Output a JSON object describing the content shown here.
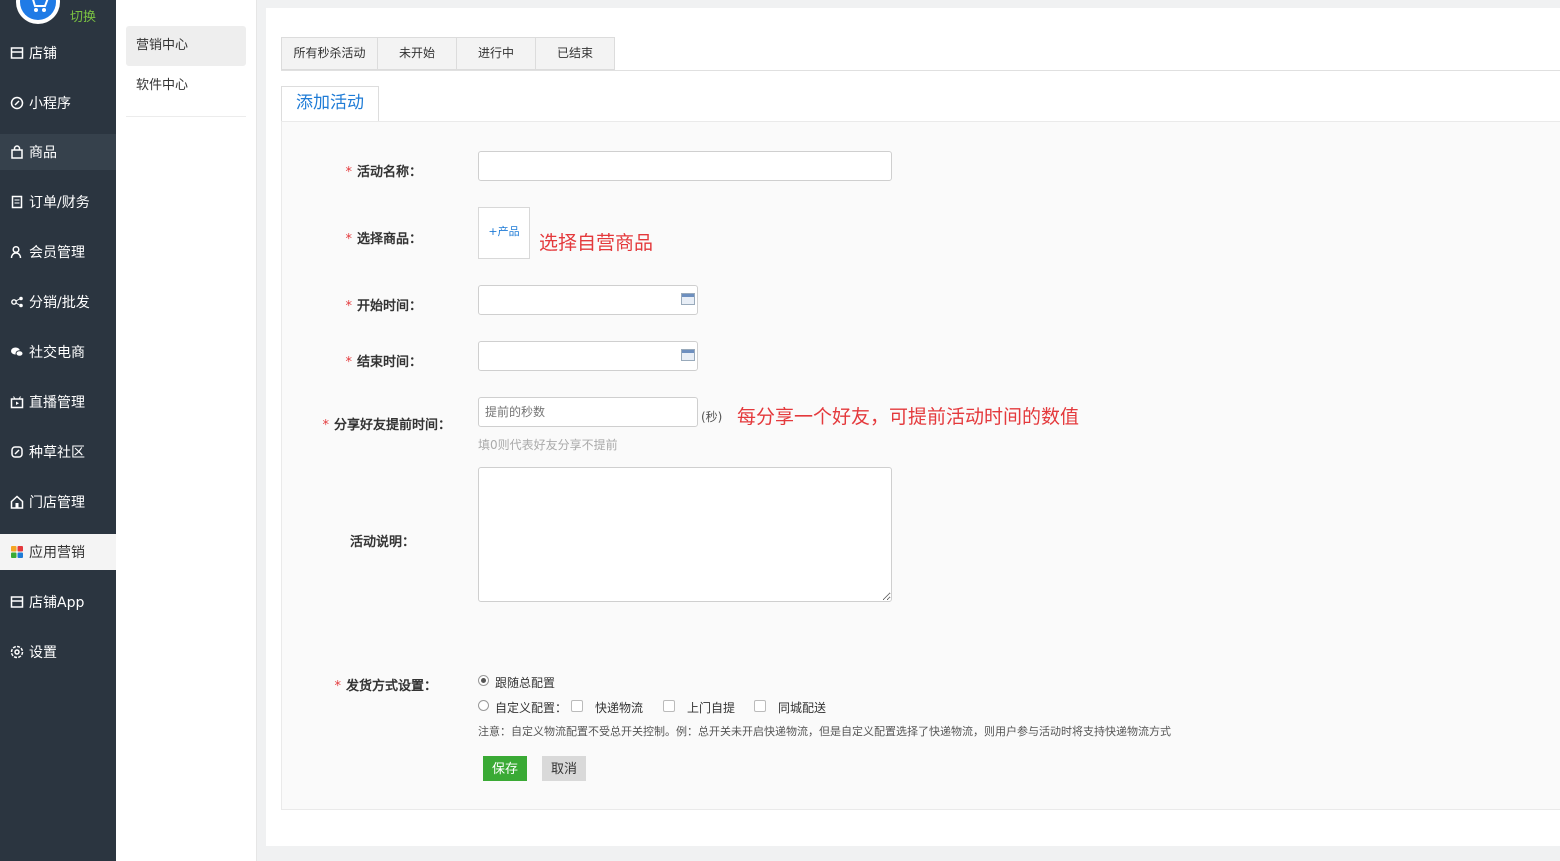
{
  "sidebar": {
    "switch_label": "切换",
    "items": [
      {
        "label": "店铺",
        "icon": "store-icon"
      },
      {
        "label": "小程序",
        "icon": "link-icon"
      },
      {
        "label": "商品",
        "icon": "bag-icon"
      },
      {
        "label": "订单/财务",
        "icon": "clipboard-icon"
      },
      {
        "label": "会员管理",
        "icon": "user-icon"
      },
      {
        "label": "分销/批发",
        "icon": "share-nodes-icon"
      },
      {
        "label": "社交电商",
        "icon": "chat-icon"
      },
      {
        "label": "直播管理",
        "icon": "video-icon"
      },
      {
        "label": "种草社区",
        "icon": "leaf-icon"
      },
      {
        "label": "门店管理",
        "icon": "home-icon"
      },
      {
        "label": "应用营销",
        "icon": "apps-icon"
      },
      {
        "label": "店铺App",
        "icon": "store-icon"
      },
      {
        "label": "设置",
        "icon": "gear-icon"
      }
    ],
    "active_index": 10
  },
  "subnav": {
    "items": [
      {
        "label": "营销中心"
      },
      {
        "label": "软件中心"
      }
    ]
  },
  "tabs": [
    "所有秒杀活动",
    "未开始",
    "进行中",
    "已结束"
  ],
  "subtab": "添加活动",
  "form": {
    "required_mark": "*",
    "activity_name_label": "活动名称：",
    "product_label": "选择商品：",
    "product_button": "+产品",
    "product_note": "选择自营商品",
    "start_time_label": "开始时间：",
    "end_time_label": "结束时间：",
    "share_label": "分享好友提前时间：",
    "share_placeholder": "提前的秒数",
    "share_unit": "(秒)",
    "share_note": "每分享一个好友，可提前活动时间的数值",
    "share_hint": "填0则代表好友分享不提前",
    "description_label": "活动说明：",
    "delivery_label": "发货方式设置：",
    "delivery_follow": "跟随总配置",
    "delivery_custom": "自定义配置：",
    "delivery_express": "快递物流",
    "delivery_pickup": "上门自提",
    "delivery_local": "同城配送",
    "delivery_note": "注意：自定义物流配置不受总开关控制。例：总开关未开启快递物流，但是自定义配置选择了快递物流，则用户参与活动时将支持快递物流方式",
    "save_button": "保存",
    "cancel_button": "取消"
  },
  "colors": {
    "sidebar_bg": "#2b3540",
    "accent_blue": "#1e7bd6",
    "required_red": "#e4393c",
    "save_green": "#3aaa35",
    "switch_green": "#7ac142"
  }
}
